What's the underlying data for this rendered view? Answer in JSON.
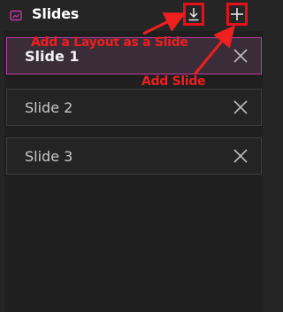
{
  "header": {
    "title": "Slides",
    "icon": "slides-icon",
    "buttons": {
      "add_layout_icon": "download-arrow-icon",
      "add_slide_icon": "plus-icon"
    }
  },
  "slides": [
    {
      "label": "Slide 1",
      "selected": true
    },
    {
      "label": "Slide 2",
      "selected": false
    },
    {
      "label": "Slide 3",
      "selected": false
    }
  ],
  "annotations": {
    "add_layout": "Add a Layout as a Slide",
    "add_slide": "Add Slide"
  },
  "colors": {
    "accent": "#c33aa4",
    "annotation": "#ee1f1f",
    "background": "#252525"
  }
}
